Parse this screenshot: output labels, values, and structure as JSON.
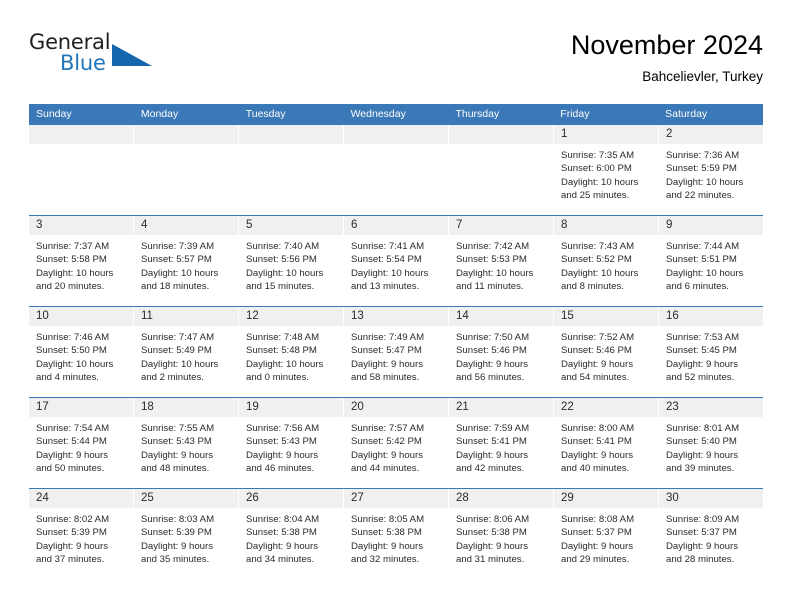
{
  "brand": {
    "name_part1": "General",
    "name_part2": "Blue",
    "triangle_color": "#1467ad",
    "blue_color": "#2175b8"
  },
  "header": {
    "title": "November 2024",
    "subtitle": "Bahcelievler, Turkey"
  },
  "theme": {
    "header_row_bg": "#3b78b7",
    "cell_head_bg": "#f0f0f0",
    "row_divider": "#3b78b7",
    "text": "#2b2b2b"
  },
  "weekdays": [
    "Sunday",
    "Monday",
    "Tuesday",
    "Wednesday",
    "Thursday",
    "Friday",
    "Saturday"
  ],
  "weeks": [
    [
      {
        "day": "",
        "empty": true
      },
      {
        "day": "",
        "empty": true
      },
      {
        "day": "",
        "empty": true
      },
      {
        "day": "",
        "empty": true
      },
      {
        "day": "",
        "empty": true
      },
      {
        "day": "1",
        "sunrise": "Sunrise: 7:35 AM",
        "sunset": "Sunset: 6:00 PM",
        "daylight1": "Daylight: 10 hours",
        "daylight2": "and 25 minutes."
      },
      {
        "day": "2",
        "sunrise": "Sunrise: 7:36 AM",
        "sunset": "Sunset: 5:59 PM",
        "daylight1": "Daylight: 10 hours",
        "daylight2": "and 22 minutes."
      }
    ],
    [
      {
        "day": "3",
        "sunrise": "Sunrise: 7:37 AM",
        "sunset": "Sunset: 5:58 PM",
        "daylight1": "Daylight: 10 hours",
        "daylight2": "and 20 minutes."
      },
      {
        "day": "4",
        "sunrise": "Sunrise: 7:39 AM",
        "sunset": "Sunset: 5:57 PM",
        "daylight1": "Daylight: 10 hours",
        "daylight2": "and 18 minutes."
      },
      {
        "day": "5",
        "sunrise": "Sunrise: 7:40 AM",
        "sunset": "Sunset: 5:56 PM",
        "daylight1": "Daylight: 10 hours",
        "daylight2": "and 15 minutes."
      },
      {
        "day": "6",
        "sunrise": "Sunrise: 7:41 AM",
        "sunset": "Sunset: 5:54 PM",
        "daylight1": "Daylight: 10 hours",
        "daylight2": "and 13 minutes."
      },
      {
        "day": "7",
        "sunrise": "Sunrise: 7:42 AM",
        "sunset": "Sunset: 5:53 PM",
        "daylight1": "Daylight: 10 hours",
        "daylight2": "and 11 minutes."
      },
      {
        "day": "8",
        "sunrise": "Sunrise: 7:43 AM",
        "sunset": "Sunset: 5:52 PM",
        "daylight1": "Daylight: 10 hours",
        "daylight2": "and 8 minutes."
      },
      {
        "day": "9",
        "sunrise": "Sunrise: 7:44 AM",
        "sunset": "Sunset: 5:51 PM",
        "daylight1": "Daylight: 10 hours",
        "daylight2": "and 6 minutes."
      }
    ],
    [
      {
        "day": "10",
        "sunrise": "Sunrise: 7:46 AM",
        "sunset": "Sunset: 5:50 PM",
        "daylight1": "Daylight: 10 hours",
        "daylight2": "and 4 minutes."
      },
      {
        "day": "11",
        "sunrise": "Sunrise: 7:47 AM",
        "sunset": "Sunset: 5:49 PM",
        "daylight1": "Daylight: 10 hours",
        "daylight2": "and 2 minutes."
      },
      {
        "day": "12",
        "sunrise": "Sunrise: 7:48 AM",
        "sunset": "Sunset: 5:48 PM",
        "daylight1": "Daylight: 10 hours",
        "daylight2": "and 0 minutes."
      },
      {
        "day": "13",
        "sunrise": "Sunrise: 7:49 AM",
        "sunset": "Sunset: 5:47 PM",
        "daylight1": "Daylight: 9 hours",
        "daylight2": "and 58 minutes."
      },
      {
        "day": "14",
        "sunrise": "Sunrise: 7:50 AM",
        "sunset": "Sunset: 5:46 PM",
        "daylight1": "Daylight: 9 hours",
        "daylight2": "and 56 minutes."
      },
      {
        "day": "15",
        "sunrise": "Sunrise: 7:52 AM",
        "sunset": "Sunset: 5:46 PM",
        "daylight1": "Daylight: 9 hours",
        "daylight2": "and 54 minutes."
      },
      {
        "day": "16",
        "sunrise": "Sunrise: 7:53 AM",
        "sunset": "Sunset: 5:45 PM",
        "daylight1": "Daylight: 9 hours",
        "daylight2": "and 52 minutes."
      }
    ],
    [
      {
        "day": "17",
        "sunrise": "Sunrise: 7:54 AM",
        "sunset": "Sunset: 5:44 PM",
        "daylight1": "Daylight: 9 hours",
        "daylight2": "and 50 minutes."
      },
      {
        "day": "18",
        "sunrise": "Sunrise: 7:55 AM",
        "sunset": "Sunset: 5:43 PM",
        "daylight1": "Daylight: 9 hours",
        "daylight2": "and 48 minutes."
      },
      {
        "day": "19",
        "sunrise": "Sunrise: 7:56 AM",
        "sunset": "Sunset: 5:43 PM",
        "daylight1": "Daylight: 9 hours",
        "daylight2": "and 46 minutes."
      },
      {
        "day": "20",
        "sunrise": "Sunrise: 7:57 AM",
        "sunset": "Sunset: 5:42 PM",
        "daylight1": "Daylight: 9 hours",
        "daylight2": "and 44 minutes."
      },
      {
        "day": "21",
        "sunrise": "Sunrise: 7:59 AM",
        "sunset": "Sunset: 5:41 PM",
        "daylight1": "Daylight: 9 hours",
        "daylight2": "and 42 minutes."
      },
      {
        "day": "22",
        "sunrise": "Sunrise: 8:00 AM",
        "sunset": "Sunset: 5:41 PM",
        "daylight1": "Daylight: 9 hours",
        "daylight2": "and 40 minutes."
      },
      {
        "day": "23",
        "sunrise": "Sunrise: 8:01 AM",
        "sunset": "Sunset: 5:40 PM",
        "daylight1": "Daylight: 9 hours",
        "daylight2": "and 39 minutes."
      }
    ],
    [
      {
        "day": "24",
        "sunrise": "Sunrise: 8:02 AM",
        "sunset": "Sunset: 5:39 PM",
        "daylight1": "Daylight: 9 hours",
        "daylight2": "and 37 minutes."
      },
      {
        "day": "25",
        "sunrise": "Sunrise: 8:03 AM",
        "sunset": "Sunset: 5:39 PM",
        "daylight1": "Daylight: 9 hours",
        "daylight2": "and 35 minutes."
      },
      {
        "day": "26",
        "sunrise": "Sunrise: 8:04 AM",
        "sunset": "Sunset: 5:38 PM",
        "daylight1": "Daylight: 9 hours",
        "daylight2": "and 34 minutes."
      },
      {
        "day": "27",
        "sunrise": "Sunrise: 8:05 AM",
        "sunset": "Sunset: 5:38 PM",
        "daylight1": "Daylight: 9 hours",
        "daylight2": "and 32 minutes."
      },
      {
        "day": "28",
        "sunrise": "Sunrise: 8:06 AM",
        "sunset": "Sunset: 5:38 PM",
        "daylight1": "Daylight: 9 hours",
        "daylight2": "and 31 minutes."
      },
      {
        "day": "29",
        "sunrise": "Sunrise: 8:08 AM",
        "sunset": "Sunset: 5:37 PM",
        "daylight1": "Daylight: 9 hours",
        "daylight2": "and 29 minutes."
      },
      {
        "day": "30",
        "sunrise": "Sunrise: 8:09 AM",
        "sunset": "Sunset: 5:37 PM",
        "daylight1": "Daylight: 9 hours",
        "daylight2": "and 28 minutes."
      }
    ]
  ]
}
